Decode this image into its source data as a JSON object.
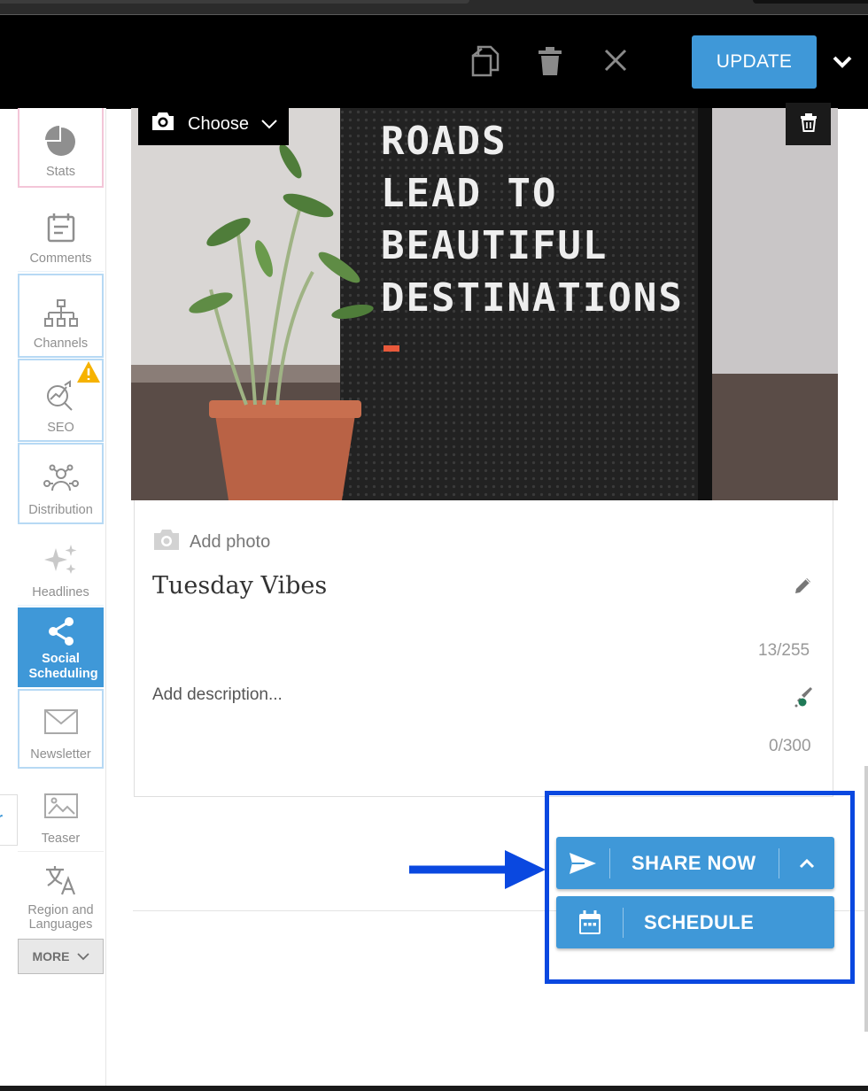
{
  "toolbar": {
    "update_label": "UPDATE",
    "icons": [
      "copy-icon",
      "trash-icon",
      "close-icon",
      "chevron-down-icon"
    ]
  },
  "sidebar": {
    "items": [
      {
        "label": "Stats",
        "icon": "pie-chart-icon"
      },
      {
        "label": "Comments",
        "icon": "calendar-note-icon"
      },
      {
        "label": "Channels",
        "icon": "hierarchy-icon"
      },
      {
        "label": "SEO",
        "icon": "seo-chart-icon",
        "badge": "!"
      },
      {
        "label": "Distribution",
        "icon": "people-network-icon"
      },
      {
        "label": "Headlines",
        "icon": "sparkle-icon"
      },
      {
        "label": "Social Scheduling",
        "icon": "share-icon",
        "active": true
      },
      {
        "label": "Newsletter",
        "icon": "envelope-icon"
      },
      {
        "label": "Teaser",
        "icon": "image-icon"
      },
      {
        "label": "Region and Languages",
        "icon": "translate-icon"
      }
    ],
    "more_label": "MORE"
  },
  "media": {
    "choose_label": "Choose",
    "image_text": [
      "ROADS",
      "LEAD TO",
      "BEAUTIFUL",
      "DESTINATIONS"
    ]
  },
  "post": {
    "add_photo_label": "Add photo",
    "title": "Tuesday Vibes",
    "title_counter": "13/255",
    "description_placeholder": "Add description...",
    "description_counter": "0/300"
  },
  "actions": {
    "share_now_label": "SHARE NOW",
    "schedule_label": "SCHEDULE"
  },
  "colors": {
    "accent": "#3f98d8",
    "highlight": "#0a48e0",
    "warning": "#f6b200"
  }
}
